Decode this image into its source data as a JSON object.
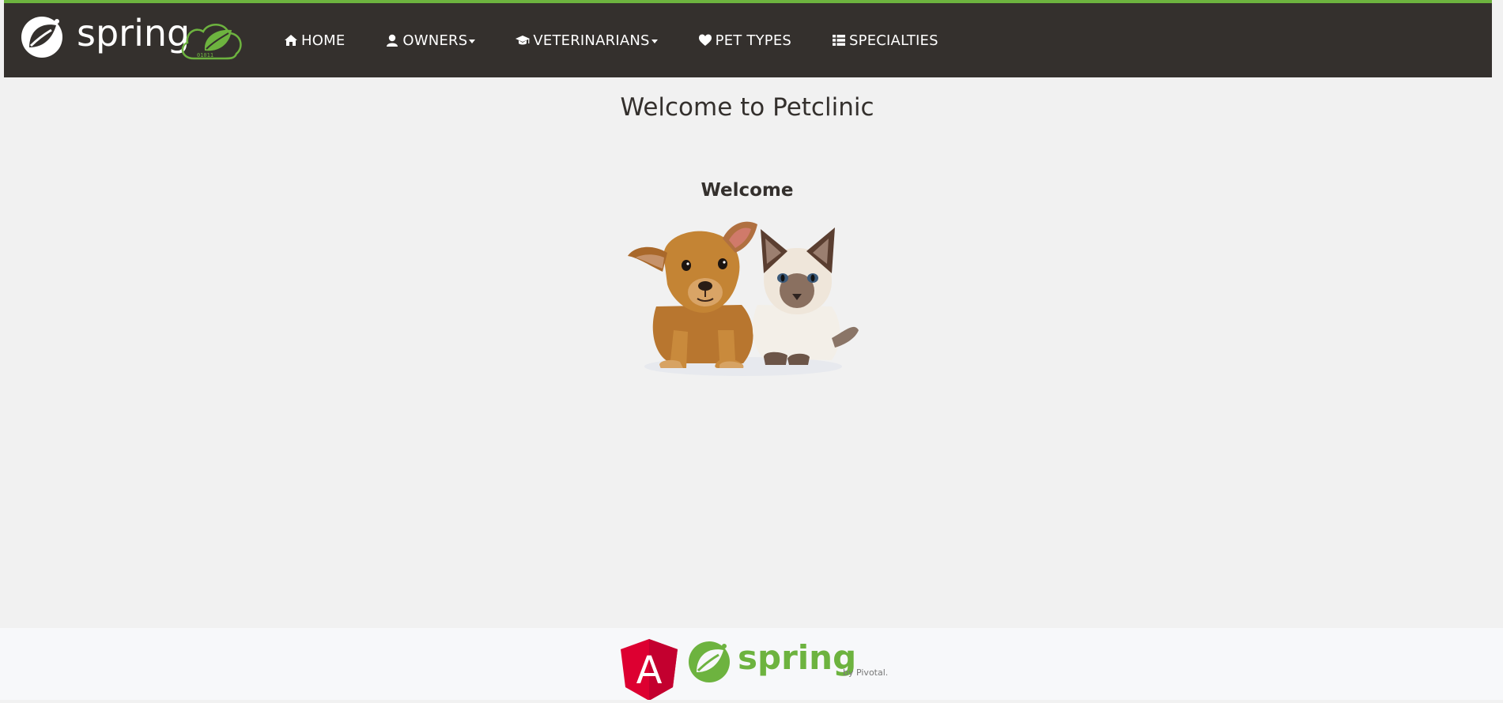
{
  "navbar": {
    "logo_text": "spring",
    "logo_badge_text": "01011",
    "items": [
      {
        "icon": "home-icon",
        "label": "HOME",
        "dropdown": false
      },
      {
        "icon": "user-icon",
        "label": "OWNERS",
        "dropdown": true
      },
      {
        "icon": "graduation-cap-icon",
        "label": "VETERINARIANS",
        "dropdown": true
      },
      {
        "icon": "heart-icon",
        "label": "PET TYPES",
        "dropdown": false
      },
      {
        "icon": "list-icon",
        "label": "SPECIALTIES",
        "dropdown": false
      }
    ]
  },
  "main": {
    "title": "Welcome to Petclinic",
    "welcome_heading": "Welcome",
    "image_alt": "pets"
  },
  "footer": {
    "angular_logo_letter": "A",
    "spring_logo_text": "spring",
    "pivotal_text": "by Pivotal."
  },
  "colors": {
    "brand_green": "#6db33f",
    "navbar_bg": "#34302d",
    "angular_red": "#dd0031",
    "page_bg": "#f1f1f1"
  }
}
